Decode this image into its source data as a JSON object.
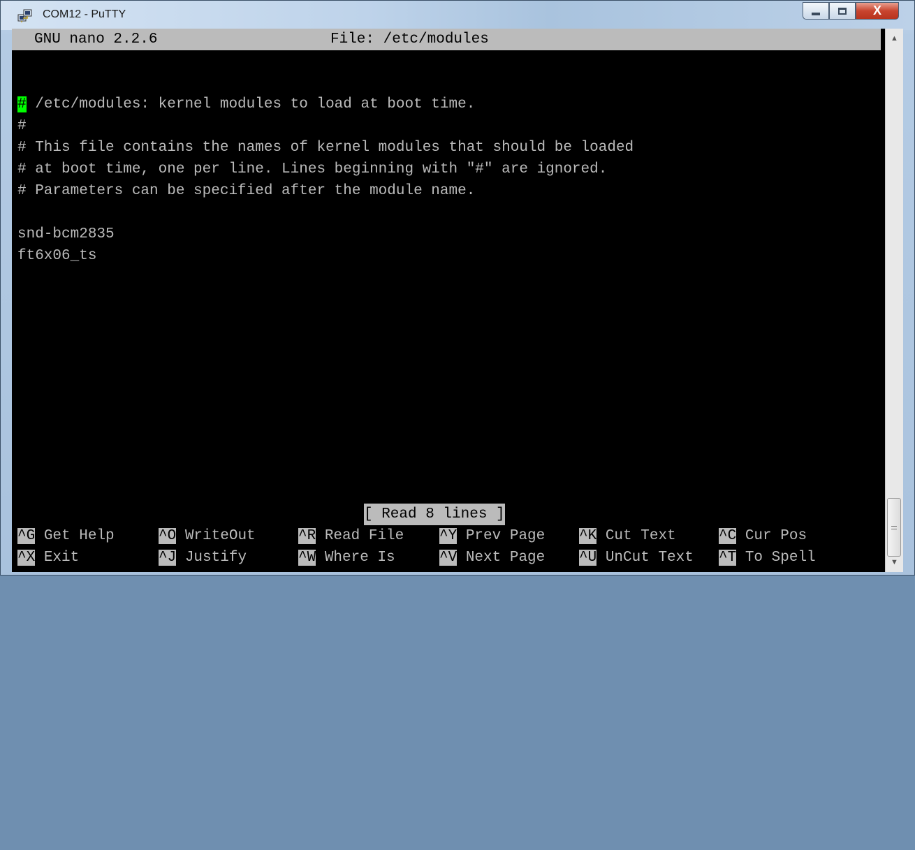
{
  "window": {
    "title": "COM12 - PuTTY",
    "close_glyph": "X"
  },
  "nano": {
    "version": "GNU nano 2.2.6",
    "file_label": "File: /etc/modules"
  },
  "editor": {
    "cursor_char": "#",
    "lines": [
      " /etc/modules: kernel modules to load at boot time.",
      "#",
      "# This file contains the names of kernel modules that should be loaded",
      "# at boot time, one per line. Lines beginning with \"#\" are ignored.",
      "# Parameters can be specified after the module name.",
      "",
      "snd-bcm2835",
      "ft6x06_ts"
    ]
  },
  "status_message": "[ Read 8 lines ]",
  "shortcuts": [
    {
      "key": "^G",
      "label": "Get Help"
    },
    {
      "key": "^O",
      "label": "WriteOut"
    },
    {
      "key": "^R",
      "label": "Read File"
    },
    {
      "key": "^Y",
      "label": "Prev Page"
    },
    {
      "key": "^K",
      "label": "Cut Text"
    },
    {
      "key": "^C",
      "label": "Cur Pos"
    },
    {
      "key": "^X",
      "label": "Exit"
    },
    {
      "key": "^J",
      "label": "Justify"
    },
    {
      "key": "^W",
      "label": "Where Is"
    },
    {
      "key": "^V",
      "label": "Next Page"
    },
    {
      "key": "^U",
      "label": "UnCut Text"
    },
    {
      "key": "^T",
      "label": "To Spell"
    }
  ],
  "colors": {
    "terminal_bg": "#000000",
    "terminal_fg": "#bbbbbb",
    "cursor": "#00ff00",
    "reverse_bg": "#bbbbbb"
  },
  "icons": {
    "app": "putty-icon",
    "minimize": "minimize-icon",
    "maximize": "maximize-icon",
    "close": "close-icon",
    "scroll_up": "scroll-up-arrow-icon",
    "scroll_down": "scroll-down-arrow-icon"
  }
}
